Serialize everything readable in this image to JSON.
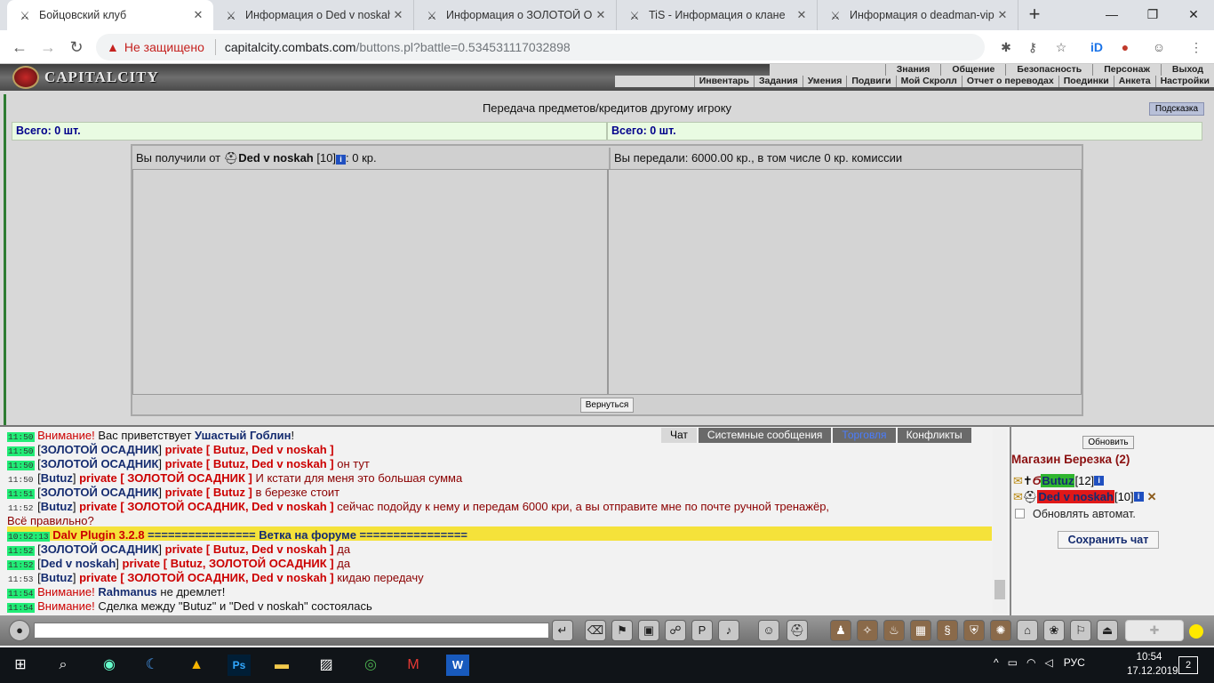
{
  "browser": {
    "tabs": [
      {
        "title": "Бойцовский клуб",
        "active": true
      },
      {
        "title": "Информация о Ded v noskah",
        "active": false
      },
      {
        "title": "Информация о ЗОЛОТОЙ ОС",
        "active": false
      },
      {
        "title": "TiS - Информация о клане",
        "active": false
      },
      {
        "title": "Информация о deadman-vip",
        "active": false
      }
    ],
    "new_tab": "+",
    "window": {
      "minimize": "—",
      "restore": "❐",
      "close": "✕"
    },
    "security_label": "Не защищено",
    "url_host": "capitalcity.combats.com",
    "url_path": "/buttons.pl?battle=0.534531117032898"
  },
  "game": {
    "logo_text": "CAPITALCITY",
    "top_menu": [
      "Знания",
      "Общение",
      "Безопасность",
      "Персонаж",
      "Выход"
    ],
    "sub_menu": [
      "Инвентарь",
      "Задания",
      "Умения",
      "Подвиги",
      "Мой Скролл",
      "Отчет о переводах",
      "Поединки",
      "Анкета",
      "Настройки"
    ],
    "page_title": "Передача предметов/кредитов другому игроку",
    "hint_button": "Подсказка",
    "total_left": "Всего: 0 шт.",
    "total_right": "Всего: 0 шт.",
    "received_prefix": "Вы получили от ",
    "received_name": "Ded v noskah",
    "received_level": " [10]",
    "received_suffix": ": 0 кр.",
    "sent_text": "Вы передали: 6000.00 кр., в том числе 0 кр. комиссии",
    "back_button": "Вернуться"
  },
  "chat": {
    "tabs": [
      "Чат",
      "Системные сообщения",
      "Торговля",
      "Конфликты"
    ],
    "lines": [
      {
        "time": "11:50",
        "parts": [
          [
            "rd",
            "Внимание! "
          ],
          [
            "n",
            "Вас приветствует "
          ],
          [
            "bl",
            "Ушастый Гоблин"
          ],
          [
            "n",
            "!"
          ]
        ]
      },
      {
        "time": "11:50",
        "parts": [
          [
            "n",
            "["
          ],
          [
            "bl",
            "ЗОЛОТОЙ ОСАДНИК"
          ],
          [
            "n",
            "] "
          ],
          [
            "pr",
            "private [ Butuz, Ded v noskah ]"
          ]
        ]
      },
      {
        "time": "11:50",
        "parts": [
          [
            "n",
            "["
          ],
          [
            "bl",
            "ЗОЛОТОЙ ОСАДНИК"
          ],
          [
            "n",
            "] "
          ],
          [
            "pr",
            "private [ Butuz, Ded v noskah ]"
          ],
          [
            "sm",
            " он тут"
          ]
        ]
      },
      {
        "time": "11:50",
        "plain": true,
        "parts": [
          [
            "n",
            "["
          ],
          [
            "bl",
            "Butuz"
          ],
          [
            "n",
            "] "
          ],
          [
            "pr",
            "private [ ЗОЛОТОЙ ОСАДНИК ]"
          ],
          [
            "sm",
            " И кстати для меня это большая сумма"
          ]
        ]
      },
      {
        "time": "11:51",
        "parts": [
          [
            "n",
            "["
          ],
          [
            "bl",
            "ЗОЛОТОЙ ОСАДНИК"
          ],
          [
            "n",
            "] "
          ],
          [
            "pr",
            "private [ Butuz ]"
          ],
          [
            "sm",
            " в березке стоит"
          ]
        ]
      },
      {
        "time": "11:52",
        "plain": true,
        "parts": [
          [
            "n",
            "["
          ],
          [
            "bl",
            "Butuz"
          ],
          [
            "n",
            "] "
          ],
          [
            "pr",
            "private [ ЗОЛОТОЙ ОСАДНИК, Ded v noskah ]"
          ],
          [
            "sm",
            " сейчас подойду к нему и передам 6000 кри, а вы отправите мне по почте ручной тренажёр,"
          ]
        ]
      },
      {
        "time": "",
        "parts": [
          [
            "sm",
            "Всё правильно?"
          ]
        ]
      },
      {
        "time": "10:52:13",
        "parts": [
          [
            "pr",
            "Dalv Plugin 3.2.8"
          ],
          [
            "bl",
            "    ================ Ветка на форуме ================"
          ]
        ]
      },
      {
        "time": "11:52",
        "parts": [
          [
            "n",
            "["
          ],
          [
            "bl",
            "ЗОЛОТОЙ ОСАДНИК"
          ],
          [
            "n",
            "] "
          ],
          [
            "pr",
            "private [ Butuz, Ded v noskah ]"
          ],
          [
            "sm",
            " да"
          ]
        ]
      },
      {
        "time": "11:52",
        "parts": [
          [
            "n",
            "["
          ],
          [
            "bl",
            "Ded v noskah"
          ],
          [
            "n",
            "] "
          ],
          [
            "pr",
            "private [ Butuz, ЗОЛОТОЙ ОСАДНИК ]"
          ],
          [
            "sm",
            " да"
          ]
        ]
      },
      {
        "time": "11:53",
        "plain": true,
        "parts": [
          [
            "n",
            "["
          ],
          [
            "bl",
            "Butuz"
          ],
          [
            "n",
            "] "
          ],
          [
            "pr",
            "private [ ЗОЛОТОЙ ОСАДНИК, Ded v noskah ]"
          ],
          [
            "sm",
            " кидаю передачу"
          ]
        ]
      },
      {
        "time": "11:54",
        "parts": [
          [
            "rd",
            "Внимание! "
          ],
          [
            "bl",
            "Rahmanus"
          ],
          [
            "n",
            " не дремлет!"
          ]
        ]
      },
      {
        "time": "11:54",
        "parts": [
          [
            "rd",
            "Внимание! "
          ],
          [
            "n",
            "Сделка между \"Butuz\" и \"Ded v noskah\" состоялась"
          ]
        ]
      }
    ]
  },
  "side": {
    "refresh_button": "Обновить",
    "location": "Магазин Березка (2)",
    "users": [
      {
        "name": "Butuz",
        "level": "[12]",
        "bg": "#2fb52f"
      },
      {
        "name": "Ded v noskah",
        "level": "[10]",
        "bg": "#e01818"
      }
    ],
    "auto_label": "Обновлять автомат.",
    "save_chat": "Сохранить чат"
  },
  "taskbar": {
    "lang": "РУС",
    "time": "10:54",
    "date": "17.12.2019",
    "notifications": "2"
  }
}
